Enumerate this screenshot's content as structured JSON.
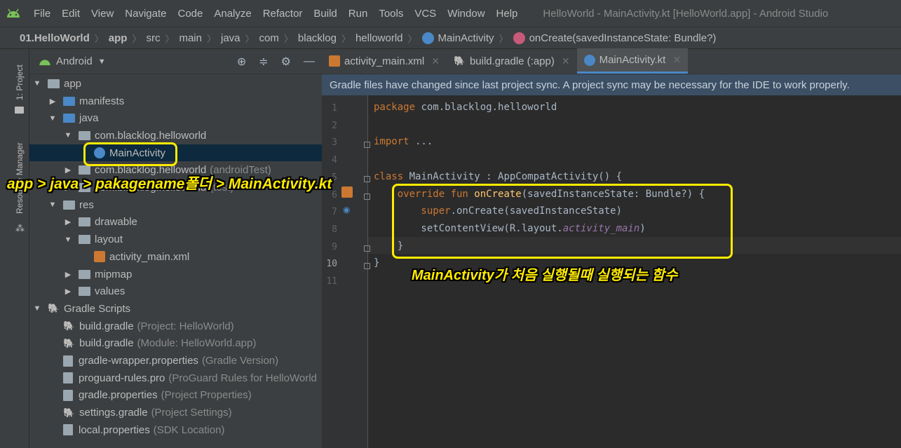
{
  "menubar": {
    "items": [
      "File",
      "Edit",
      "View",
      "Navigate",
      "Code",
      "Analyze",
      "Refactor",
      "Build",
      "Run",
      "Tools",
      "VCS",
      "Window",
      "Help"
    ],
    "window_title": "HelloWorld - MainActivity.kt [HelloWorld.app] - Android Studio"
  },
  "breadcrumb": {
    "items": [
      "01.HelloWorld",
      "app",
      "src",
      "main",
      "java",
      "com",
      "blacklog",
      "helloworld",
      "MainActivity",
      "onCreate(savedInstanceState: Bundle?)"
    ]
  },
  "side_tabs": {
    "project": "1: Project",
    "resource_manager": "Resource Manager"
  },
  "project_panel": {
    "view_selector": "Android",
    "tree": [
      {
        "label": "app",
        "hint": ""
      },
      {
        "label": "manifests",
        "hint": ""
      },
      {
        "label": "java",
        "hint": ""
      },
      {
        "label": "com.blacklog.helloworld",
        "hint": ""
      },
      {
        "label": "MainActivity",
        "hint": ""
      },
      {
        "label": "com.blacklog.helloworld",
        "hint": "(androidTest)"
      },
      {
        "label": "com.blacklog.helloworld",
        "hint": "(test)"
      },
      {
        "label": "res",
        "hint": ""
      },
      {
        "label": "drawable",
        "hint": ""
      },
      {
        "label": "layout",
        "hint": ""
      },
      {
        "label": "activity_main.xml",
        "hint": ""
      },
      {
        "label": "mipmap",
        "hint": ""
      },
      {
        "label": "values",
        "hint": ""
      },
      {
        "label": "Gradle Scripts",
        "hint": ""
      },
      {
        "label": "build.gradle",
        "hint": "(Project: HelloWorld)"
      },
      {
        "label": "build.gradle",
        "hint": "(Module: HelloWorld.app)"
      },
      {
        "label": "gradle-wrapper.properties",
        "hint": "(Gradle Version)"
      },
      {
        "label": "proguard-rules.pro",
        "hint": "(ProGuard Rules for HelloWorld"
      },
      {
        "label": "gradle.properties",
        "hint": "(Project Properties)"
      },
      {
        "label": "settings.gradle",
        "hint": "(Project Settings)"
      },
      {
        "label": "local.properties",
        "hint": "(SDK Location)"
      }
    ]
  },
  "editor": {
    "tabs": [
      {
        "label": "activity_main.xml"
      },
      {
        "label": "build.gradle (:app)"
      },
      {
        "label": "MainActivity.kt"
      }
    ],
    "banner": "Gradle files have changed since last project sync. A project sync may be necessary for the IDE to work properly.",
    "line_numbers": [
      "1",
      "2",
      "3",
      "4",
      "5",
      "6",
      "7",
      "8",
      "9",
      "10",
      "11"
    ],
    "code": {
      "l1_kw": "package",
      "l1_rest": " com.blacklog.helloworld",
      "l3_kw": "import",
      "l3_rest": " ...",
      "l6_kw": "class",
      "l6_rest": " MainActivity : AppCompatActivity() {",
      "l7_kw": "    override fun ",
      "l7_fn": "onCreate",
      "l7_rest": "(savedInstanceState: Bundle?) {",
      "l8_kw": "        super",
      "l8_rest": ".onCreate(savedInstanceState)",
      "l9_rest": "        setContentView(R.layout.",
      "l9_it": "activity_main",
      "l9_end": ")",
      "l10": "    }",
      "l11": "}"
    }
  },
  "annotations": {
    "path_note": "app > java > pakagename폴더 > MainActivity.kt",
    "func_note": "MainActivity가 처음 실행될때 실행되는 함수",
    "highlight_color": "#ffeb00"
  }
}
